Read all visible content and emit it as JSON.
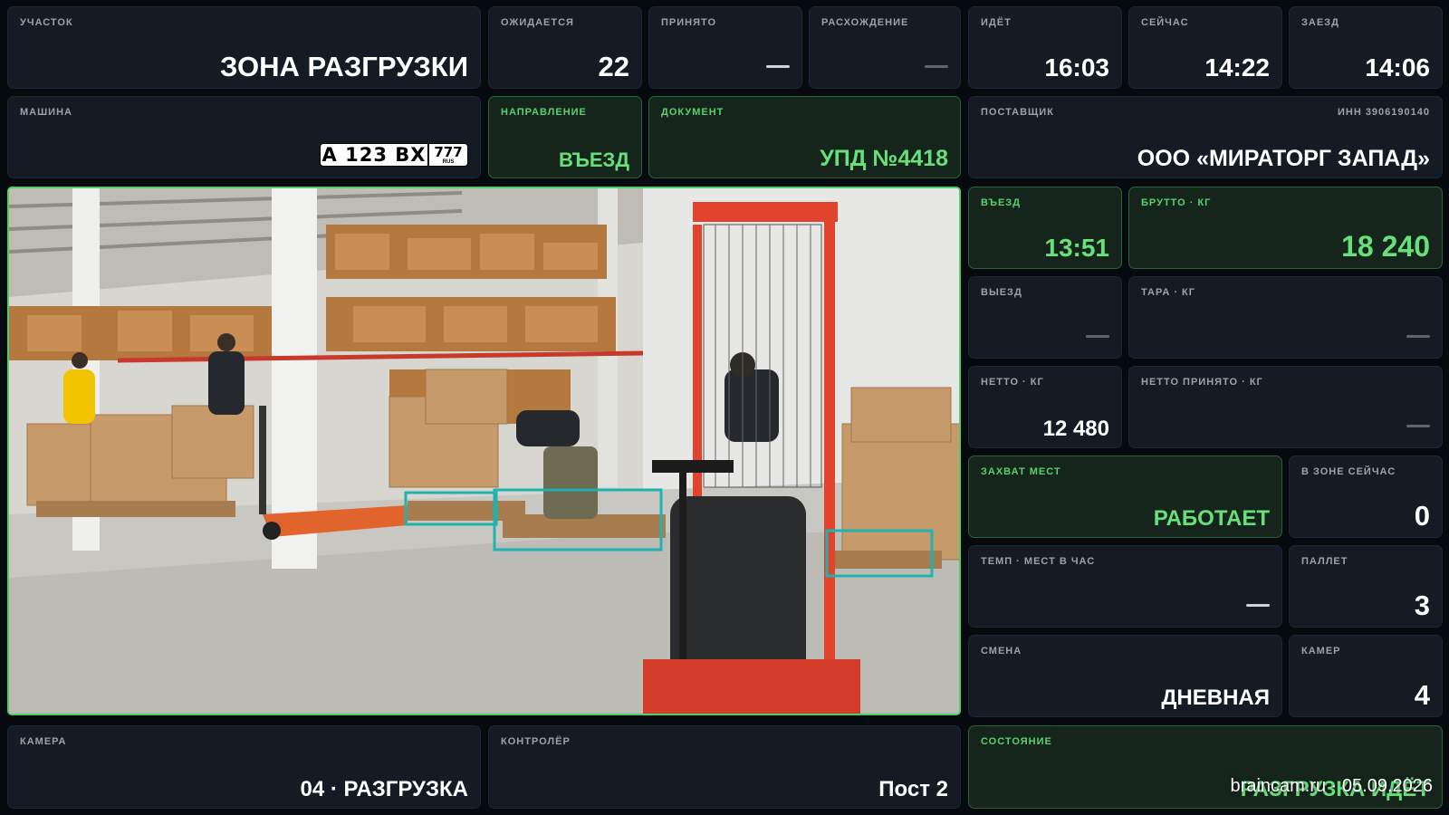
{
  "header": {
    "site": {
      "label": "УЧАСТОК",
      "value": "ЗОНА РАЗГРУЗКИ"
    },
    "expected": {
      "label": "ОЖИДАЕТСЯ",
      "value": "22"
    },
    "accepted": {
      "label": "ПРИНЯТО"
    },
    "discrepancy": {
      "label": "РАСХОЖДЕНИЕ"
    },
    "elapsed": {
      "label": "ИДЁТ",
      "value": "16:03"
    },
    "now": {
      "label": "СЕЙЧАС",
      "value": "14:22"
    },
    "arrival": {
      "label": "ЗАЕЗД",
      "value": "14:06"
    }
  },
  "vehicle": {
    "label": "МАШИНА",
    "plate_number": "А 123 ВХ",
    "plate_region": "777",
    "plate_country": "RUS"
  },
  "direction": {
    "label": "НАПРАВЛЕНИЕ",
    "value": "ВЪЕЗД"
  },
  "document": {
    "label": "ДОКУМЕНТ",
    "value": "УПД №4418"
  },
  "supplier": {
    "label": "ПОСТАВЩИК",
    "inn": "ИНН 3906190140",
    "name": "ООО «МИРАТОРГ ЗАПАД»"
  },
  "weights": {
    "entry": {
      "label": "ВЪЕЗД",
      "value": "13:51"
    },
    "gross": {
      "label": "БРУТТО · КГ",
      "value": "18 240"
    },
    "exit": {
      "label": "ВЫЕЗД"
    },
    "tare": {
      "label": "ТАРА · КГ"
    },
    "net": {
      "label": "НЕТТО · КГ",
      "value": "12 480"
    },
    "net_accepted": {
      "label": "НЕТТО ПРИНЯТО · КГ"
    }
  },
  "stats": {
    "capture": {
      "label": "ЗАХВАТ МЕСТ",
      "value": "РАБОТАЕТ"
    },
    "in_zone": {
      "label": "В ЗОНЕ СЕЙЧАС",
      "value": "0"
    },
    "pace": {
      "label": "ТЕМП · МЕСТ В ЧАС"
    },
    "pallets": {
      "label": "ПАЛЛЕТ",
      "value": "3"
    },
    "shift": {
      "label": "СМЕНА",
      "value": "ДНЕВНАЯ"
    },
    "cameras": {
      "label": "КАМЕР",
      "value": "4"
    }
  },
  "footer": {
    "camera": {
      "label": "КАМЕРА",
      "value": "04 · РАЗГРУЗКА"
    },
    "controller": {
      "label": "КОНТРОЛЁР",
      "value": "Пост 2"
    },
    "status": {
      "label": "СОСТОЯНИЕ",
      "value": "РАЗГРУЗКА ИДЁТ"
    }
  },
  "watermark": "braincam.ru · 05.09.2026",
  "colors": {
    "accent_green": "#67e07c",
    "tile_bg": "#141b25",
    "green_tile_bg": "#15251b",
    "detection_box": "#1fb3b0"
  }
}
